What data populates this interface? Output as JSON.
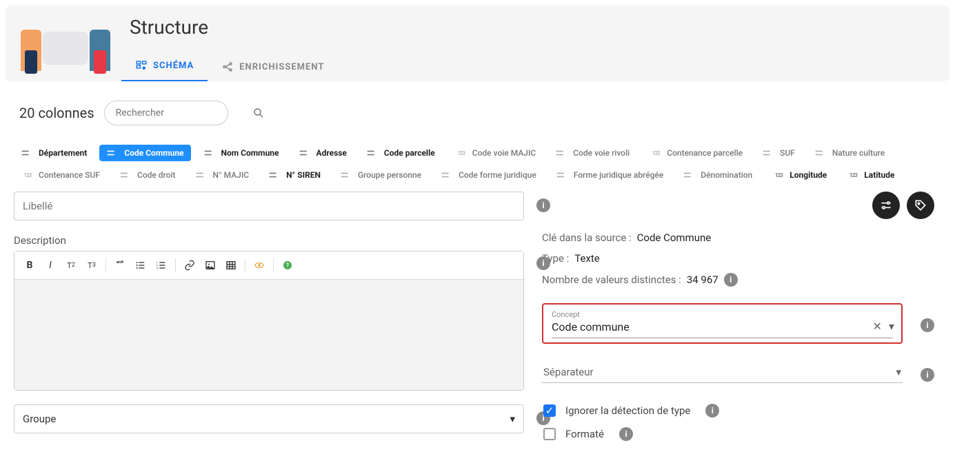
{
  "header": {
    "title": "Structure"
  },
  "tabs": [
    {
      "label": "SCHÉMA",
      "active": true
    },
    {
      "label": "ENRICHISSEMENT",
      "active": false
    }
  ],
  "columns_count_label": "20 colonnes",
  "search": {
    "placeholder": "Rechercher"
  },
  "chips": [
    {
      "type": "abc",
      "label": "Département",
      "bold": true
    },
    {
      "type": "abc",
      "label": "Code Commune",
      "bold": true,
      "active": true
    },
    {
      "type": "abc",
      "label": "Nom Commune",
      "bold": true
    },
    {
      "type": "abc",
      "label": "Adresse",
      "bold": true
    },
    {
      "type": "abc",
      "label": "Code parcelle",
      "bold": true
    },
    {
      "type": "123",
      "label": "Code voie MAJIC",
      "bold": false
    },
    {
      "type": "abc",
      "label": "Code voie rivoli",
      "bold": false
    },
    {
      "type": "123",
      "label": "Contenance parcelle",
      "bold": false
    },
    {
      "type": "abc",
      "label": "SUF",
      "bold": false
    },
    {
      "type": "abc",
      "label": "Nature culture",
      "bold": false
    },
    {
      "type": "123",
      "label": "Contenance SUF",
      "bold": false
    },
    {
      "type": "abc",
      "label": "Code droit",
      "bold": false
    },
    {
      "type": "abc",
      "label": "N° MAJIC",
      "bold": false
    },
    {
      "type": "abc",
      "label": "N° SIREN",
      "bold": true
    },
    {
      "type": "abc",
      "label": "Groupe personne",
      "bold": false
    },
    {
      "type": "abc",
      "label": "Code forme juridique",
      "bold": false
    },
    {
      "type": "abc",
      "label": "Forme juridique abrégée",
      "bold": false
    },
    {
      "type": "abc",
      "label": "Dénomination",
      "bold": false
    },
    {
      "type": "123",
      "label": "Longitude",
      "bold": true
    },
    {
      "type": "123",
      "label": "Latitude",
      "bold": true
    }
  ],
  "form": {
    "libelle_placeholder": "Libellé",
    "description_label": "Description",
    "groupe_label": "Groupe"
  },
  "meta": {
    "key_label": "Clé dans la source :",
    "key_value": "Code Commune",
    "type_label": "Type :",
    "type_value": "Texte",
    "distinct_label": "Nombre de valeurs distinctes :",
    "distinct_value": "34 967"
  },
  "concept": {
    "label": "Concept",
    "value": "Code commune"
  },
  "separator": {
    "label": "Séparateur"
  },
  "checks": {
    "ignore_type": "Ignorer la détection de type",
    "formatted": "Formaté"
  },
  "icons": {
    "info": "i"
  }
}
